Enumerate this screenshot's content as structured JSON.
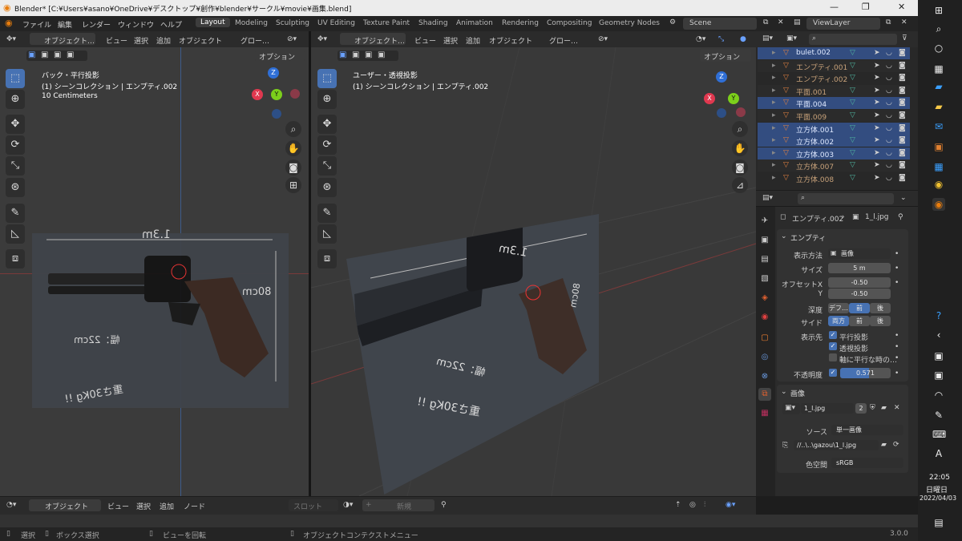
{
  "window": {
    "title": "Blender* [C:¥Users¥asano¥OneDrive¥デスクトップ¥創作¥blender¥サークル¥movie¥画集.blend]",
    "minimize": "—",
    "maximize": "❐",
    "close": "✕"
  },
  "menu": [
    "ファイル",
    "編集",
    "レンダー",
    "ウィンドウ",
    "ヘルプ"
  ],
  "workspaces": [
    "Layout",
    "Modeling",
    "Sculpting",
    "UV Editing",
    "Texture Paint",
    "Shading",
    "Animation",
    "Rendering",
    "Compositing",
    "Geometry Nodes"
  ],
  "scene": "Scene",
  "view_layer": "ViewLayer",
  "left_view": {
    "header": [
      "オブジェクト…",
      "ビュー",
      "選択",
      "追加",
      "オブジェクト",
      "グロー…"
    ],
    "options": "オプション",
    "info_line1": "バック・平行投影",
    "info_line2": "(1) シーンコレクション | エンプティ.002",
    "info_line3": "10 Centimeters",
    "img_label_width": "1.3m",
    "img_label_height": "80cm",
    "img_label_w22": "幅：22cm",
    "img_label_weight": "重さ30Kg !!"
  },
  "right_view": {
    "header": [
      "オブジェクト…",
      "ビュー",
      "選択",
      "追加",
      "オブジェクト",
      "グロー…"
    ],
    "options": "オプション",
    "info_line1": "ユーザー・透視投影",
    "info_line2": "(1) シーンコレクション | エンプティ.002",
    "img_label_width": "1.3m",
    "img_label_height": "80cm",
    "img_label_w22": "幅：22cm",
    "img_label_weight": "重さ30Kg !!"
  },
  "gizmo": {
    "x": "X",
    "y": "Y",
    "z": "Z"
  },
  "outliner": [
    {
      "name": "bulet.002",
      "selected": true
    },
    {
      "name": "エンプティ.001",
      "selected": false
    },
    {
      "name": "エンプティ.002",
      "selected": false
    },
    {
      "name": "平面.001",
      "selected": false
    },
    {
      "name": "平面.004",
      "selected": true
    },
    {
      "name": "平面.009",
      "selected": false
    },
    {
      "name": "立方体.001",
      "selected": true
    },
    {
      "name": "立方体.002",
      "selected": true
    },
    {
      "name": "立方体.003",
      "selected": true
    },
    {
      "name": "立方体.007",
      "selected": false
    },
    {
      "name": "立方体.008",
      "selected": false
    }
  ],
  "props": {
    "breadcrumb_obj": "エンプティ.002",
    "breadcrumb_img": "1_l.jpg",
    "section_empty": "エンプティ",
    "display_label": "表示方法",
    "display_value": "画像",
    "size_label": "サイズ",
    "size_value": "5 m",
    "offsetx_label": "オフセットX",
    "offsetx_value": "-0.50",
    "y_label": "Y",
    "y_value": "-0.50",
    "depth_label": "深度",
    "depth_opts": [
      "デフ…",
      "前",
      "後"
    ],
    "side_label": "サイド",
    "side_opts": [
      "両方",
      "前",
      "後"
    ],
    "show_label": "表示先",
    "show_ortho": "平行投影",
    "show_persp": "透視投影",
    "show_axis": "軸に平行な時の…",
    "opacity_label": "不透明度",
    "opacity_value": "0.571",
    "opacity_fraction": 0.571,
    "section_image": "画像",
    "image_name": "1_l.jpg",
    "image_users": "2",
    "source_label": "ソース",
    "source_value": "単一画像",
    "path_value": "//..\\..\\gazou\\1_l.jpg",
    "colorspace_label": "色空間",
    "colorspace_value": "sRGB"
  },
  "timeline": {
    "mode": "オブジェクト",
    "menus": [
      "ビュー",
      "選択",
      "追加",
      "ノード"
    ],
    "slot": "スロット",
    "new": "新規"
  },
  "statusbar": {
    "select": "選択",
    "box_select": "ボックス選択",
    "rotate": "ビューを回転",
    "context": "オブジェクトコンテクストメニュー",
    "version": "3.0.0"
  },
  "clock": {
    "time": "22:05",
    "day": "日曜日",
    "date": "2022/04/03"
  },
  "taskbar_ime": "A"
}
